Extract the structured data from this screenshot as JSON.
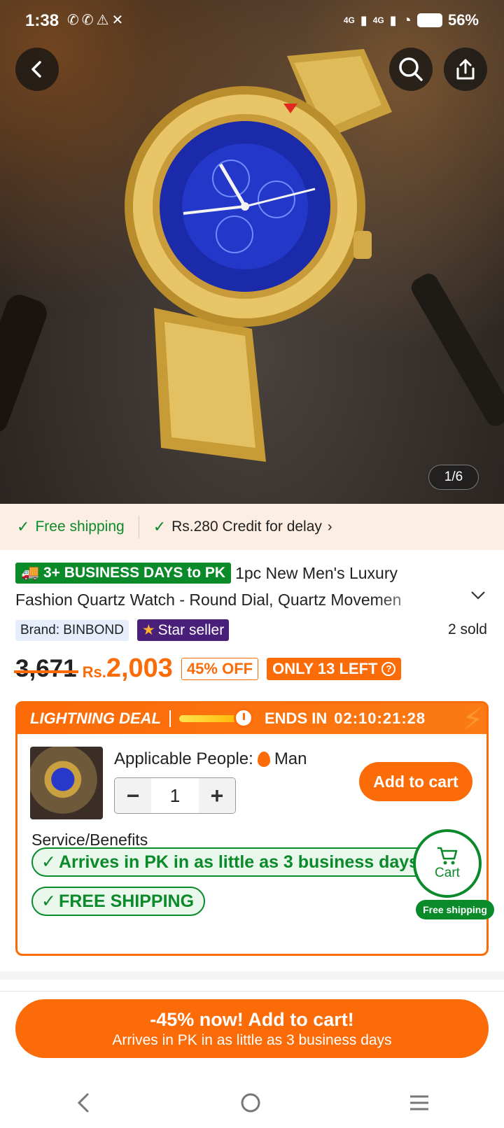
{
  "status_bar": {
    "time": "1:38",
    "network_1": "4G",
    "network_2": "4G",
    "battery": "56%"
  },
  "hero": {
    "image_counter": "1/6",
    "icons": {
      "back": "chevron-left-icon",
      "search": "search-icon",
      "share": "share-icon"
    }
  },
  "shipping": {
    "free_shipping": "Free shipping",
    "credit": "Rs.280 Credit for delay"
  },
  "product": {
    "delivery_badge": "3+ BUSINESS DAYS to PK",
    "title_line_1": "1pc New Men's Luxury",
    "title_line_2": "Fashion Quartz Watch - Round Dial, Quartz Movemen",
    "brand": "Brand: BINBOND",
    "star_seller": "Star seller",
    "sold": "2 sold"
  },
  "price": {
    "original": "3,671",
    "currency": "Rs.",
    "current": "2,003",
    "discount": "45% OFF",
    "stock": "ONLY 13 LEFT"
  },
  "deal": {
    "title": "LIGHTNING DEAL",
    "ends_label": "ENDS IN",
    "countdown": "02:10:21:28",
    "applicable_label": "Applicable People:",
    "applicable_value": "Man",
    "quantity": "1",
    "add_to_cart": "Add to cart",
    "service_title": "Service/Benefits",
    "benefit_1": "Arrives in PK in as little as 3 business days",
    "benefit_2": "FREE SHIPPING"
  },
  "floating_cart": {
    "label": "Cart",
    "badge": "Free shipping"
  },
  "cta": {
    "main": "-45% now! Add to cart!",
    "sub": "Arrives in PK in as little as 3 business days"
  },
  "colors": {
    "accent": "#fb6b08",
    "green": "#0b8a2a",
    "star_seller": "#4a1f7a"
  }
}
